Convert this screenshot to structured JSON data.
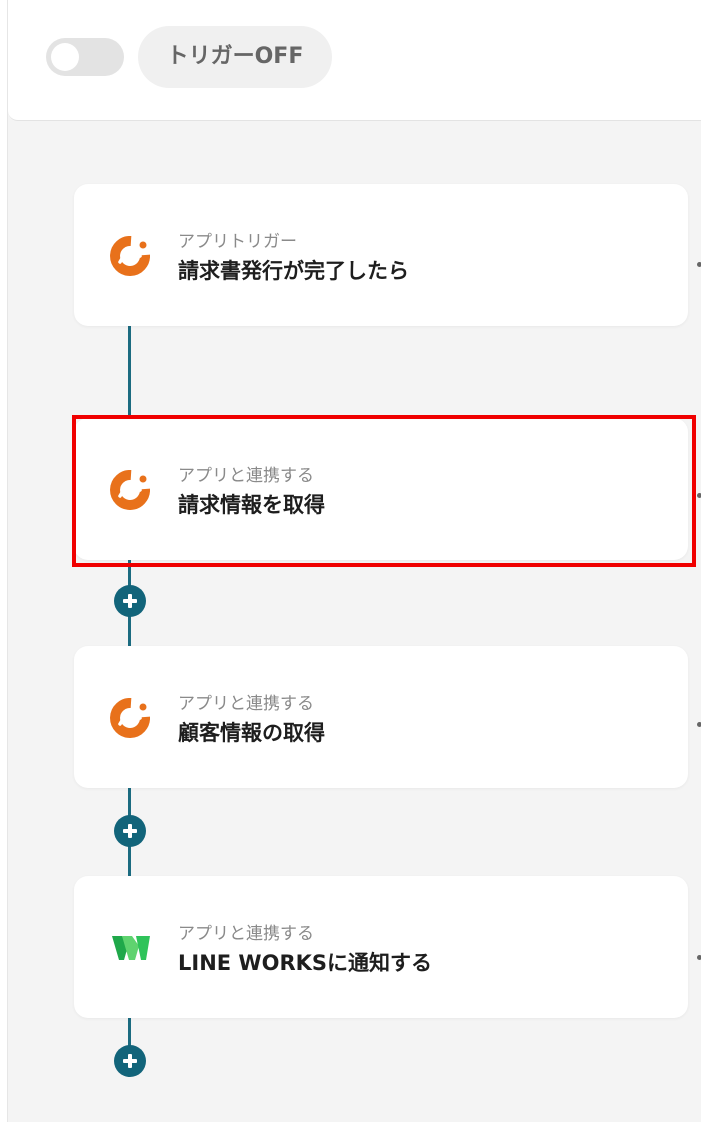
{
  "topbar": {
    "trigger_toggle": "off",
    "trigger_label": "トリガーOFF"
  },
  "colors": {
    "accent": "#12647a",
    "highlight": "#f00000",
    "app_orange": "#e8711b",
    "app_green": "#2fc35a"
  },
  "steps": [
    {
      "type_label": "アプリトリガー",
      "title": "請求書発行が完了したら",
      "icon": "orange-app-icon"
    },
    {
      "type_label": "アプリと連携する",
      "title": "請求情報を取得",
      "icon": "orange-app-icon",
      "highlighted": true
    },
    {
      "type_label": "アプリと連携する",
      "title": "顧客情報の取得",
      "icon": "orange-app-icon"
    },
    {
      "type_label": "アプリと連携する",
      "title": "LINE WORKSに通知する",
      "icon": "line-works-icon"
    }
  ]
}
